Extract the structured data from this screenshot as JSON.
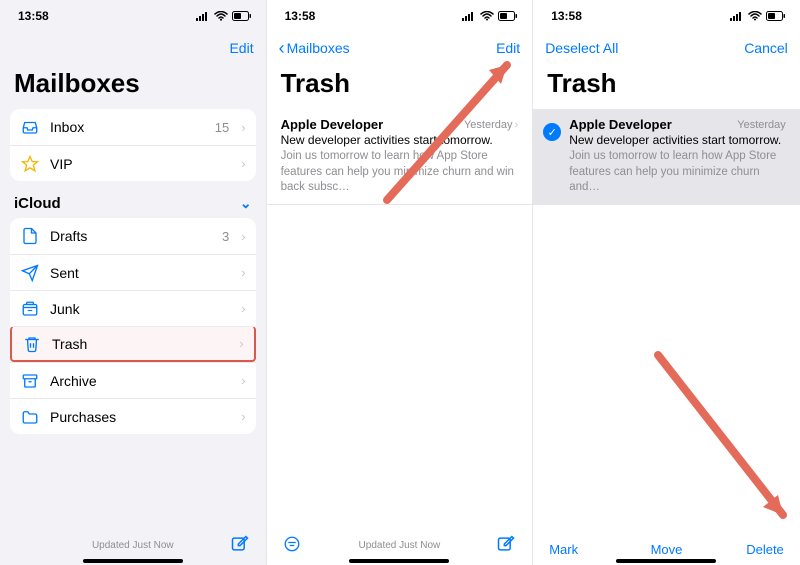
{
  "status": {
    "time": "13:58"
  },
  "screen1": {
    "nav_edit": "Edit",
    "title": "Mailboxes",
    "primary": [
      {
        "icon": "inbox",
        "label": "Inbox",
        "count": "15"
      },
      {
        "icon": "star",
        "label": "VIP",
        "count": ""
      }
    ],
    "section": "iCloud",
    "folders": [
      {
        "icon": "drafts",
        "label": "Drafts",
        "count": "3",
        "hl": false
      },
      {
        "icon": "sent",
        "label": "Sent",
        "count": "",
        "hl": false
      },
      {
        "icon": "junk",
        "label": "Junk",
        "count": "",
        "hl": false
      },
      {
        "icon": "trash",
        "label": "Trash",
        "count": "",
        "hl": true
      },
      {
        "icon": "archive",
        "label": "Archive",
        "count": "",
        "hl": false
      },
      {
        "icon": "folder",
        "label": "Purchases",
        "count": "",
        "hl": false
      }
    ],
    "status_text": "Updated Just Now"
  },
  "screen2": {
    "back": "Mailboxes",
    "nav_edit": "Edit",
    "title": "Trash",
    "msg": {
      "sender": "Apple Developer",
      "date": "Yesterday",
      "subject": "New developer activities start tomorrow.",
      "preview": "Join us tomorrow to learn how App Store features can help you minimize churn and win back subsc…"
    },
    "status_text": "Updated Just Now"
  },
  "screen3": {
    "deselect": "Deselect All",
    "cancel": "Cancel",
    "title": "Trash",
    "msg": {
      "sender": "Apple Developer",
      "date": "Yesterday",
      "subject": "New developer activities start tomorrow.",
      "preview": "Join us tomorrow to learn how App Store features can help you minimize churn and…"
    },
    "mark": "Mark",
    "move": "Move",
    "delete": "Delete"
  }
}
